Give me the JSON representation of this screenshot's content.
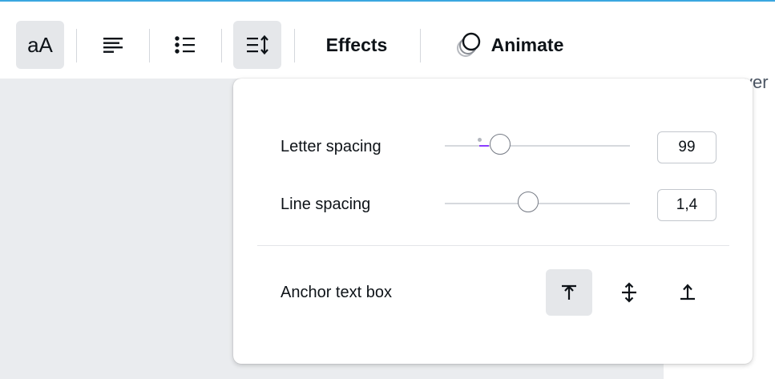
{
  "canvas": {
    "partial_text": "ver"
  },
  "toolbar": {
    "font_case_label": "aA",
    "effects_label": "Effects",
    "animate_label": "Animate"
  },
  "spacing_panel": {
    "letter_spacing": {
      "label": "Letter spacing",
      "value": "99",
      "slider_fraction": 0.3
    },
    "line_spacing": {
      "label": "Line spacing",
      "value": "1,4",
      "slider_fraction": 0.45
    },
    "anchor": {
      "label": "Anchor text box",
      "options": [
        "anchor-top-icon",
        "anchor-middle-icon",
        "anchor-bottom-icon"
      ],
      "selected": "anchor-top-icon"
    }
  },
  "colors": {
    "accent": "#8b3dff",
    "topbar_border": "#3aa7e0",
    "active_bg": "#e5e7ea"
  }
}
